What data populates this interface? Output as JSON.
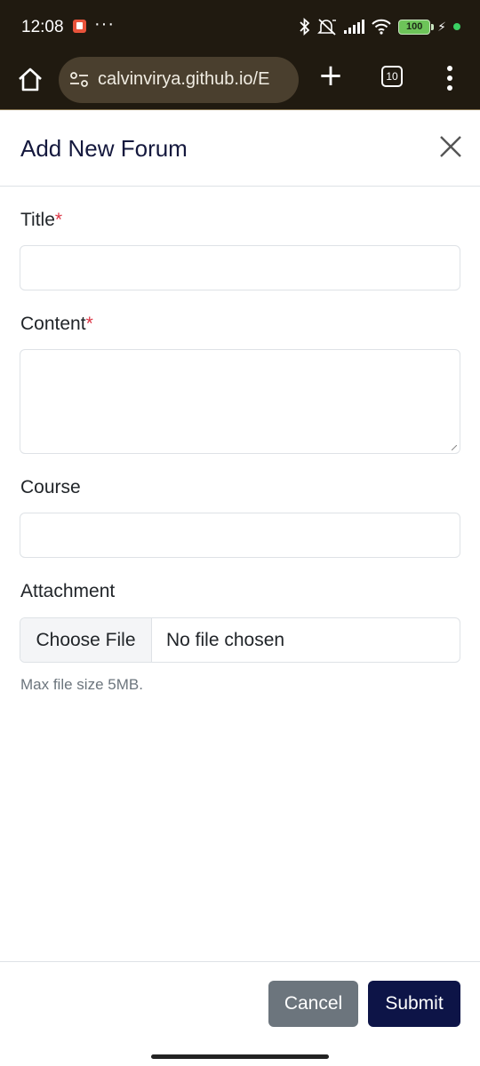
{
  "status_bar": {
    "time": "12:08",
    "overflow": "···",
    "battery": "100",
    "icons": [
      "app-notification-icon",
      "bluetooth-icon",
      "mute-icon",
      "signal-icon",
      "wifi-icon",
      "battery-icon",
      "charging-icon"
    ]
  },
  "browser": {
    "url": "calvinvirya.github.io/E",
    "tab_count": "10",
    "icons": [
      "home-icon",
      "site-settings-icon",
      "plus-icon",
      "tabs-icon",
      "menu-icon"
    ]
  },
  "modal": {
    "title": "Add New Forum",
    "close_icon": "close-icon"
  },
  "form": {
    "title_label": "Title",
    "content_label": "Content",
    "required_mark": "*",
    "course_label": "Course",
    "attachment_label": "Attachment",
    "title_value": "",
    "content_value": "",
    "course_value": "",
    "choose_file": "Choose File",
    "file_status": "No file chosen",
    "help": "Max file size 5MB."
  },
  "footer": {
    "cancel": "Cancel",
    "submit": "Submit"
  },
  "colors": {
    "header_bg": "#201a10",
    "title_color": "#14183d",
    "required": "#dc3545",
    "cancel_bg": "#6c757d",
    "submit_bg": "#0d1447"
  }
}
